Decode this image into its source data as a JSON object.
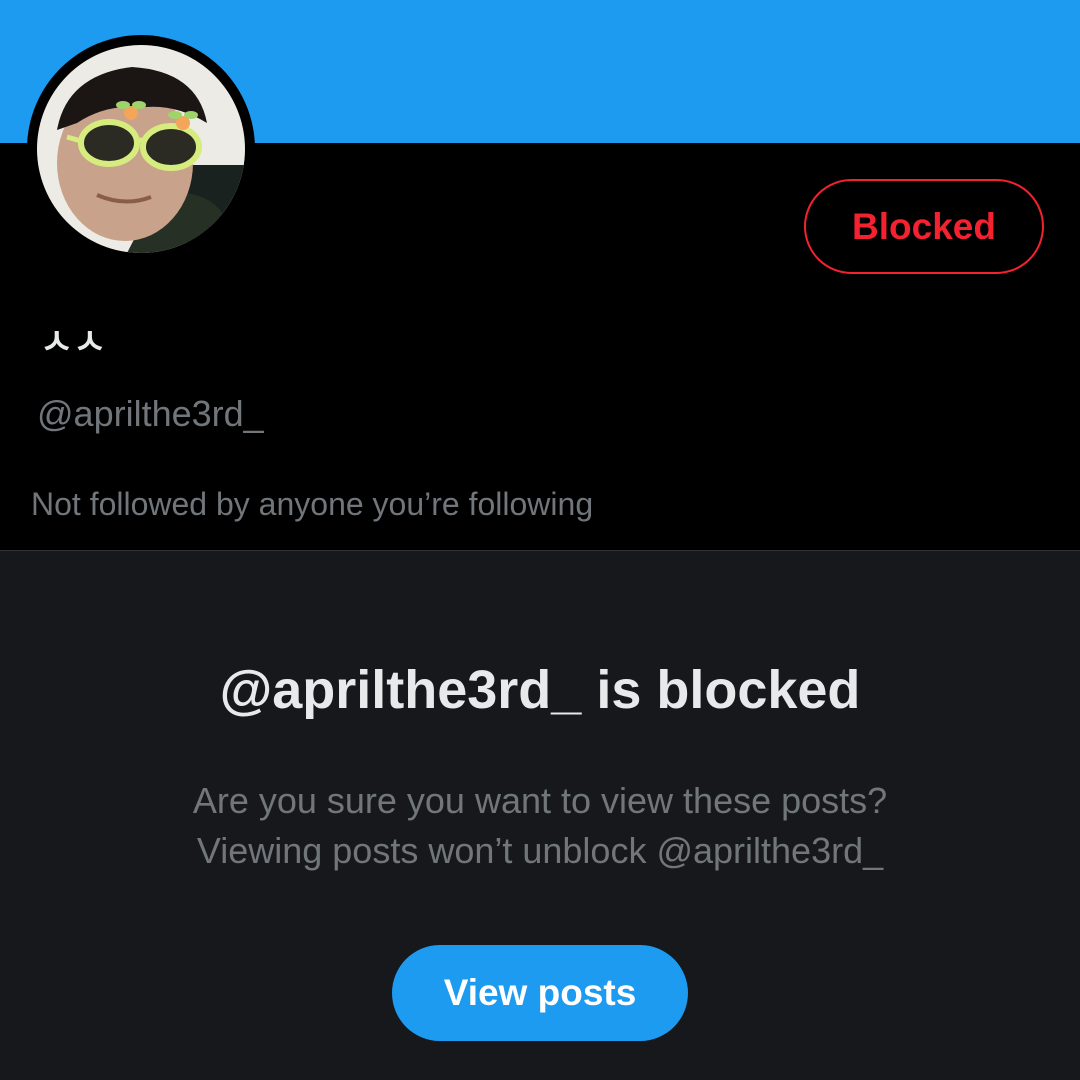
{
  "colors": {
    "banner": "#1d9bf0",
    "profile_bg": "#000000",
    "blocked_panel_bg": "#16181c",
    "blocked_accent": "#f4212e",
    "primary_button": "#1d9bf0",
    "text_primary": "#e7e9ea",
    "text_secondary": "#71767b"
  },
  "profile": {
    "avatar_icon": "profile-photo",
    "display_name": "ㅅㅅ",
    "handle": "@aprilthe3rd_",
    "followed_by": "Not followed by anyone you’re following",
    "blocked_button_label": "Blocked"
  },
  "blocked_notice": {
    "title": "@aprilthe3rd_ is blocked",
    "line1": "Are you sure you want to view these posts?",
    "line2": "Viewing posts won’t unblock @aprilthe3rd_",
    "button_label": "View posts"
  }
}
